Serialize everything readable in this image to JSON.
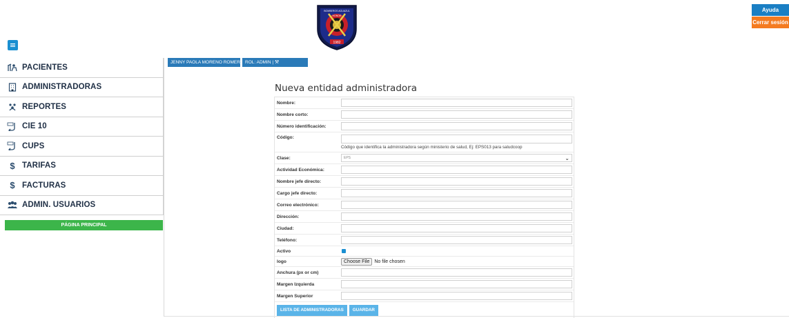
{
  "header": {
    "help_label": "Ayuda",
    "logout_label": "Cerrar sesión",
    "logo_text_top": "BOMBEROS AGUAZUL",
    "logo_text_honor": "HONOR",
    "logo_year": "1982"
  },
  "sidebar": {
    "items": [
      {
        "label": "PACIENTES",
        "icon": "patients-icon"
      },
      {
        "label": "ADMINISTRADORAS",
        "icon": "building-icon"
      },
      {
        "label": "REPORTES",
        "icon": "reports-icon"
      },
      {
        "label": "CIE 10",
        "icon": "cie10-icon"
      },
      {
        "label": "CUPS",
        "icon": "cups-icon"
      },
      {
        "label": "TARIFAS",
        "icon": "dollar-icon"
      },
      {
        "label": "FACTURAS",
        "icon": "dollar-icon"
      },
      {
        "label": "ADMIN. USUARIOS",
        "icon": "users-icon"
      }
    ],
    "home_label": "PÁGINA PRINCIPAL"
  },
  "user_bar": {
    "user": "JENNY PAOLA MORENO ROMERO |",
    "role": "ROL: ADMIN |"
  },
  "form": {
    "title": "Nueva entidad administradora",
    "fields": {
      "nombre": {
        "label": "Nombre:",
        "value": ""
      },
      "nombre_corto": {
        "label": "Nombre corto:",
        "value": ""
      },
      "numero_identificacion": {
        "label": "Número identificación:",
        "value": ""
      },
      "codigo": {
        "label": "Código:",
        "value": "",
        "hint": "Código que identifica la administradora según ministerio de salud, Ej: EPS013 para saludcoop"
      },
      "clase": {
        "label": "Clase:",
        "value": "EPS"
      },
      "actividad_economica": {
        "label": "Actividad Económica:",
        "value": ""
      },
      "nombre_jefe": {
        "label": "Nombre jefe directo:",
        "value": ""
      },
      "cargo_jefe": {
        "label": "Cargo jefe directo:",
        "value": ""
      },
      "correo": {
        "label": "Correo electrónico:",
        "value": ""
      },
      "direccion": {
        "label": "Dirección:",
        "value": ""
      },
      "ciudad": {
        "label": "Ciudad:",
        "value": ""
      },
      "telefono": {
        "label": "Teléfono:",
        "value": ""
      },
      "activo": {
        "label": "Activo",
        "checked": true
      },
      "logo": {
        "label": "logo",
        "button": "Choose File",
        "status": "No file chosen"
      },
      "anchura": {
        "label": "Anchura (px or cm)",
        "value": ""
      },
      "margen_izquierda": {
        "label": "Margen Izquierda",
        "value": ""
      },
      "margen_superior": {
        "label": "Margen Superior",
        "value": ""
      }
    },
    "buttons": {
      "list_label": "LISTA DE ADMINISTRADORAS",
      "save_label": "GUARDAR"
    }
  },
  "colors": {
    "primary": "#1a7fc4",
    "logout": "#f47b20",
    "home": "#3cb54a",
    "action": "#5ab4e8"
  }
}
